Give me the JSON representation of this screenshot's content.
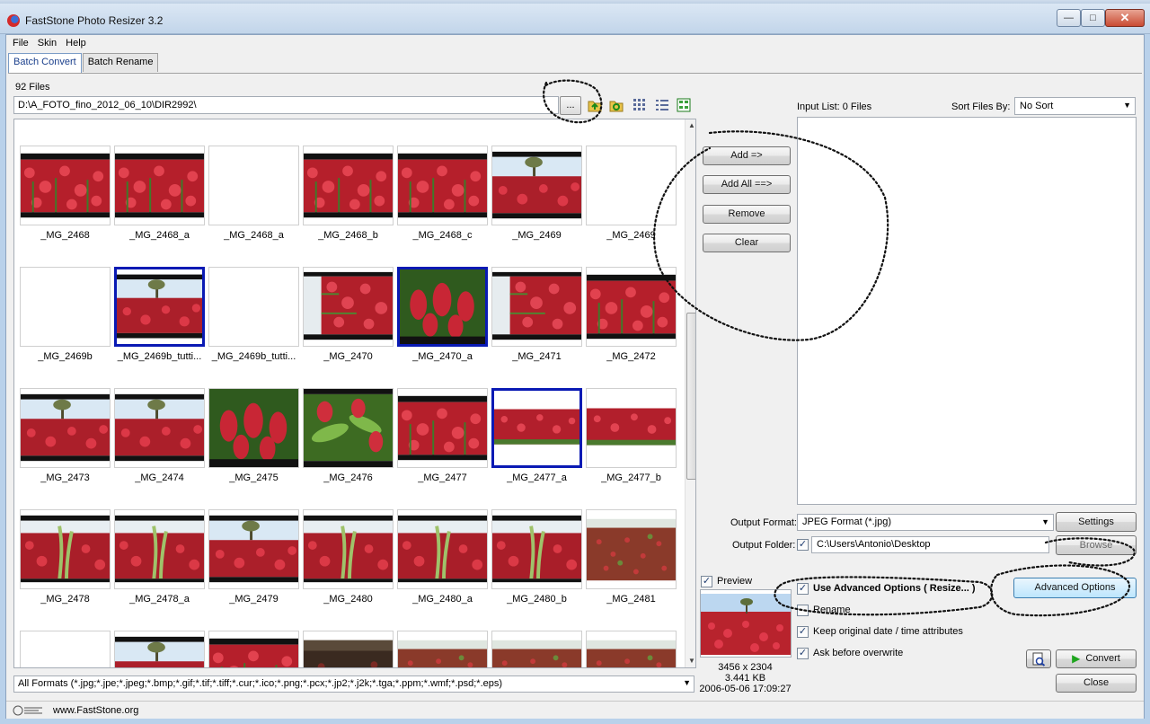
{
  "window": {
    "title": "FastStone Photo Resizer 3.2"
  },
  "menu": [
    "File",
    "Skin",
    "Help"
  ],
  "tabs": [
    "Batch Convert",
    "Batch Rename"
  ],
  "browser": {
    "file_count": "92 Files",
    "path": "D:\\A_FOTO_fino_2012_06_10\\DIR2992\\",
    "browse_label": "...",
    "format_filter": "All Formats (*.jpg;*.jpe;*.jpeg;*.bmp;*.gif;*.tif;*.tiff;*.cur;*.ico;*.png;*.pcx;*.jp2;*.j2k;*.tga;*.ppm;*.wmf;*.psd;*.eps)"
  },
  "thumbnails": [
    {
      "label": "_MG_2468",
      "kind": "field",
      "selected": false
    },
    {
      "label": "_MG_2468_a",
      "kind": "field",
      "selected": false
    },
    {
      "label": "_MG_2468_a",
      "kind": "blank",
      "selected": false
    },
    {
      "label": "_MG_2468_b",
      "kind": "field",
      "selected": false
    },
    {
      "label": "_MG_2468_c",
      "kind": "field",
      "selected": false
    },
    {
      "label": "_MG_2469",
      "kind": "tree",
      "selected": false
    },
    {
      "label": "_MG_2469",
      "kind": "blank",
      "selected": false
    },
    {
      "label": "_MG_2469b",
      "kind": "blank",
      "selected": false
    },
    {
      "label": "_MG_2469b_tutti...",
      "kind": "tree",
      "selected": true
    },
    {
      "label": "_MG_2469b_tutti...",
      "kind": "blank",
      "selected": false
    },
    {
      "label": "_MG_2470",
      "kind": "rotated",
      "selected": false
    },
    {
      "label": "_MG_2470_a",
      "kind": "closeup",
      "selected": true
    },
    {
      "label": "_MG_2471",
      "kind": "rotated",
      "selected": false
    },
    {
      "label": "_MG_2472",
      "kind": "field",
      "selected": false
    },
    {
      "label": "_MG_2473",
      "kind": "tree",
      "selected": false
    },
    {
      "label": "_MG_2474",
      "kind": "tree",
      "selected": false
    },
    {
      "label": "_MG_2475",
      "kind": "closeup",
      "selected": false
    },
    {
      "label": "_MG_2476",
      "kind": "leaves",
      "selected": false
    },
    {
      "label": "_MG_2477",
      "kind": "field",
      "selected": false
    },
    {
      "label": "_MG_2477_a",
      "kind": "strip",
      "selected": true
    },
    {
      "label": "_MG_2477_b",
      "kind": "strip",
      "selected": false
    },
    {
      "label": "_MG_2478",
      "kind": "wheat",
      "selected": false
    },
    {
      "label": "_MG_2478_a",
      "kind": "wheat",
      "selected": false
    },
    {
      "label": "_MG_2479",
      "kind": "tree",
      "selected": false
    },
    {
      "label": "_MG_2480",
      "kind": "wheat",
      "selected": false
    },
    {
      "label": "_MG_2480_a",
      "kind": "wheat",
      "selected": false
    },
    {
      "label": "_MG_2480_b",
      "kind": "wheat",
      "selected": false
    },
    {
      "label": "_MG_2481",
      "kind": "meadow",
      "selected": false
    },
    {
      "label": "",
      "kind": "blank",
      "selected": false
    },
    {
      "label": "",
      "kind": "tree",
      "selected": false
    },
    {
      "label": "",
      "kind": "field",
      "selected": false
    },
    {
      "label": "",
      "kind": "dark",
      "selected": false
    },
    {
      "label": "",
      "kind": "meadow",
      "selected": false
    },
    {
      "label": "",
      "kind": "meadow",
      "selected": false
    },
    {
      "label": "",
      "kind": "meadow",
      "selected": false
    }
  ],
  "actions": {
    "add": "Add =>",
    "add_all": "Add All ==>",
    "remove": "Remove",
    "clear": "Clear"
  },
  "input_list": {
    "label": "Input List:  0 Files",
    "sort_label": "Sort Files By:",
    "sort_value": "No Sort"
  },
  "output": {
    "format_label": "Output Format:",
    "format_value": "JPEG Format (*.jpg)",
    "settings": "Settings",
    "folder_label": "Output Folder:",
    "folder_value": "C:\\Users\\Antonio\\Desktop",
    "browse": "Browse"
  },
  "options": {
    "preview": "Preview",
    "use_advanced": "Use Advanced Options ( Resize... )",
    "rename": "Rename",
    "keep_date": "Keep original date / time attributes",
    "ask_overwrite": "Ask before overwrite",
    "advanced_button": "Advanced Options",
    "convert": "Convert",
    "close": "Close"
  },
  "preview_info": {
    "dimensions": "3456 x 2304",
    "size": "3.441 KB",
    "date": "2006-05-06 17:09:27"
  },
  "status": {
    "website": "www.FastStone.org"
  },
  "colors": {
    "selection": "#0a1ab4",
    "convert_arrow": "#1fa51f"
  }
}
